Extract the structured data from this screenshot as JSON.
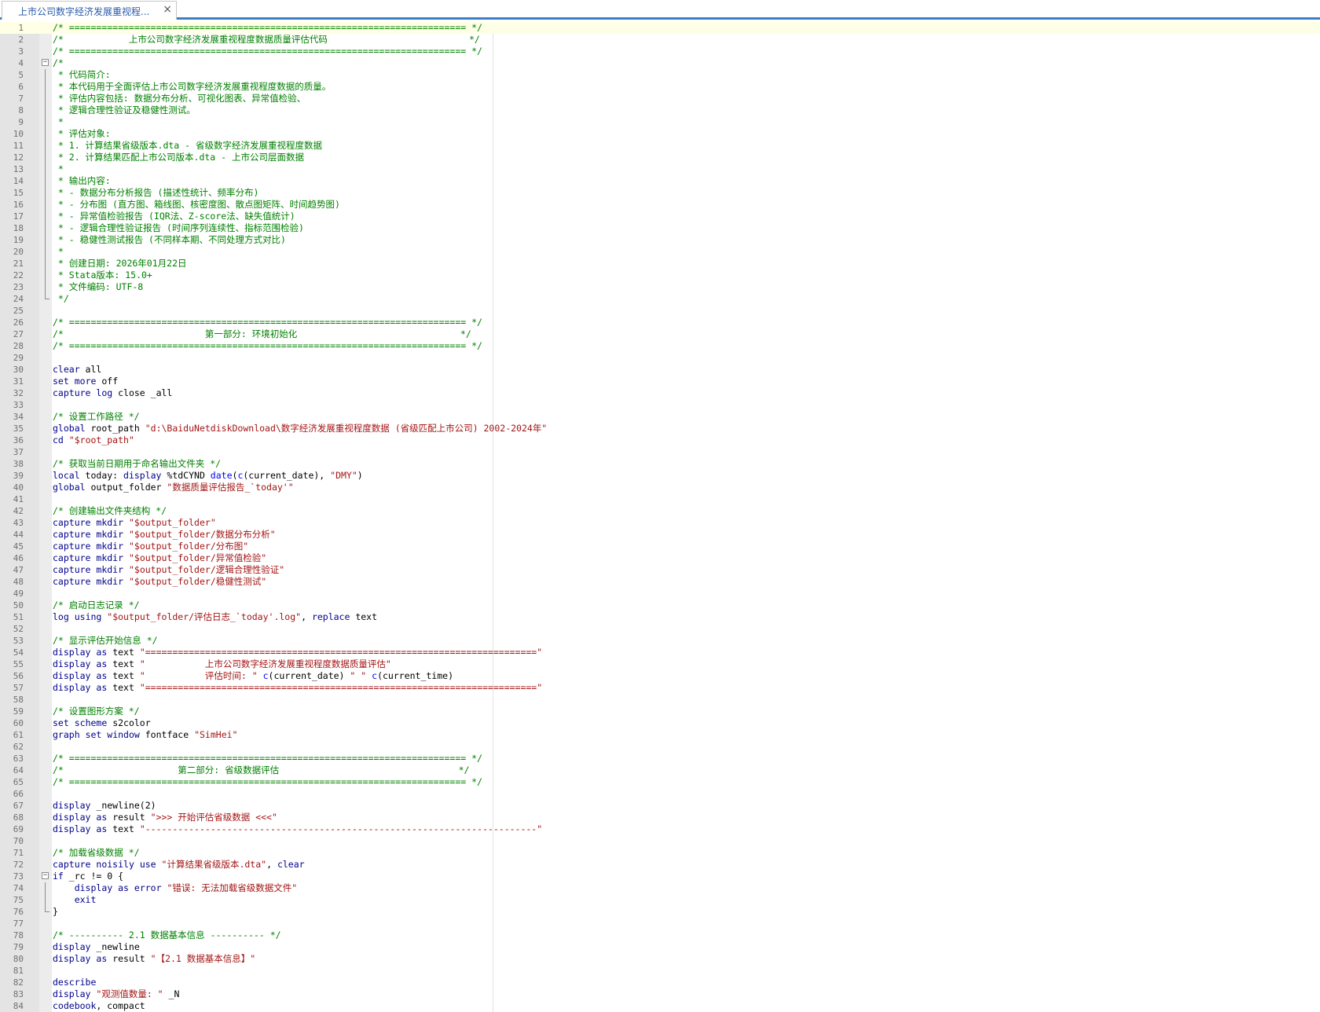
{
  "tab": {
    "title": "上市公司数字经济发展重视程...",
    "close": "×"
  },
  "colors": {
    "comment": "#008000",
    "keyword": "#00008b",
    "string": "#a31515",
    "function": "#0000ff",
    "text": "#000000",
    "active_line": "#ffffe6",
    "gutter": "#e4e4e4"
  },
  "fold_markers": {
    "4": "start",
    "24": "end",
    "73": "start",
    "76": "end"
  },
  "lines": [
    [
      [
        "c",
        "/* ========================================================================= */"
      ]
    ],
    [
      [
        "c",
        "/*            上市公司数字经济发展重视程度数据质量评估代码                          */"
      ]
    ],
    [
      [
        "c",
        "/* ========================================================================= */"
      ]
    ],
    [
      [
        "c",
        "/*"
      ]
    ],
    [
      [
        "c",
        " * 代码简介:"
      ]
    ],
    [
      [
        "c",
        " * 本代码用于全面评估上市公司数字经济发展重视程度数据的质量。"
      ]
    ],
    [
      [
        "c",
        " * 评估内容包括: 数据分布分析、可视化图表、异常值检验、"
      ]
    ],
    [
      [
        "c",
        " * 逻辑合理性验证及稳健性测试。"
      ]
    ],
    [
      [
        "c",
        " *"
      ]
    ],
    [
      [
        "c",
        " * 评估对象:"
      ]
    ],
    [
      [
        "c",
        " * 1. 计算结果省级版本.dta - 省级数字经济发展重视程度数据"
      ]
    ],
    [
      [
        "c",
        " * 2. 计算结果匹配上市公司版本.dta - 上市公司层面数据"
      ]
    ],
    [
      [
        "c",
        " *"
      ]
    ],
    [
      [
        "c",
        " * 输出内容:"
      ]
    ],
    [
      [
        "c",
        " * - 数据分布分析报告 (描述性统计、频率分布)"
      ]
    ],
    [
      [
        "c",
        " * - 分布图 (直方图、箱线图、核密度图、散点图矩阵、时间趋势图)"
      ]
    ],
    [
      [
        "c",
        " * - 异常值检验报告 (IQR法、Z-score法、缺失值统计)"
      ]
    ],
    [
      [
        "c",
        " * - 逻辑合理性验证报告 (时间序列连续性、指标范围检验)"
      ]
    ],
    [
      [
        "c",
        " * - 稳健性测试报告 (不同样本期、不同处理方式对比)"
      ]
    ],
    [
      [
        "c",
        " *"
      ]
    ],
    [
      [
        "c",
        " * 创建日期: 2026年01月22日"
      ]
    ],
    [
      [
        "c",
        " * Stata版本: 15.0+"
      ]
    ],
    [
      [
        "c",
        " * 文件编码: UTF-8"
      ]
    ],
    [
      [
        "c",
        " */"
      ]
    ],
    [],
    [
      [
        "c",
        "/* ========================================================================= */"
      ]
    ],
    [
      [
        "c",
        "/*                          第一部分: 环境初始化                              */"
      ]
    ],
    [
      [
        "c",
        "/* ========================================================================= */"
      ]
    ],
    [],
    [
      [
        "k",
        "clear"
      ],
      [
        "t",
        " all"
      ]
    ],
    [
      [
        "k",
        "set"
      ],
      [
        "t",
        " "
      ],
      [
        "k",
        "more"
      ],
      [
        "t",
        " off"
      ]
    ],
    [
      [
        "k",
        "capture"
      ],
      [
        "t",
        " "
      ],
      [
        "k",
        "log"
      ],
      [
        "t",
        " close _all"
      ]
    ],
    [],
    [
      [
        "c",
        "/* 设置工作路径 */"
      ]
    ],
    [
      [
        "k",
        "global"
      ],
      [
        "t",
        " root_path "
      ],
      [
        "s",
        "\"d:\\BaiduNetdiskDownload\\数字经济发展重视程度数据 (省级匹配上市公司) 2002-2024年\""
      ]
    ],
    [
      [
        "k",
        "cd"
      ],
      [
        "t",
        " "
      ],
      [
        "s",
        "\"$root_path\""
      ]
    ],
    [],
    [
      [
        "c",
        "/* 获取当前日期用于命名输出文件夹 */"
      ]
    ],
    [
      [
        "k",
        "local"
      ],
      [
        "t",
        " today: "
      ],
      [
        "k",
        "display"
      ],
      [
        "t",
        " %tdCYND "
      ],
      [
        "f",
        "date"
      ],
      [
        "t",
        "("
      ],
      [
        "f",
        "c"
      ],
      [
        "t",
        "(current_date), "
      ],
      [
        "s",
        "\"DMY\""
      ],
      [
        "t",
        ")"
      ]
    ],
    [
      [
        "k",
        "global"
      ],
      [
        "t",
        " output_folder "
      ],
      [
        "s",
        "\"数据质量评估报告_`today'\""
      ]
    ],
    [],
    [
      [
        "c",
        "/* 创建输出文件夹结构 */"
      ]
    ],
    [
      [
        "k",
        "capture"
      ],
      [
        "t",
        " "
      ],
      [
        "k",
        "mkdir"
      ],
      [
        "t",
        " "
      ],
      [
        "s",
        "\"$output_folder\""
      ]
    ],
    [
      [
        "k",
        "capture"
      ],
      [
        "t",
        " "
      ],
      [
        "k",
        "mkdir"
      ],
      [
        "t",
        " "
      ],
      [
        "s",
        "\"$output_folder/数据分布分析\""
      ]
    ],
    [
      [
        "k",
        "capture"
      ],
      [
        "t",
        " "
      ],
      [
        "k",
        "mkdir"
      ],
      [
        "t",
        " "
      ],
      [
        "s",
        "\"$output_folder/分布图\""
      ]
    ],
    [
      [
        "k",
        "capture"
      ],
      [
        "t",
        " "
      ],
      [
        "k",
        "mkdir"
      ],
      [
        "t",
        " "
      ],
      [
        "s",
        "\"$output_folder/异常值检验\""
      ]
    ],
    [
      [
        "k",
        "capture"
      ],
      [
        "t",
        " "
      ],
      [
        "k",
        "mkdir"
      ],
      [
        "t",
        " "
      ],
      [
        "s",
        "\"$output_folder/逻辑合理性验证\""
      ]
    ],
    [
      [
        "k",
        "capture"
      ],
      [
        "t",
        " "
      ],
      [
        "k",
        "mkdir"
      ],
      [
        "t",
        " "
      ],
      [
        "s",
        "\"$output_folder/稳健性测试\""
      ]
    ],
    [],
    [
      [
        "c",
        "/* 启动日志记录 */"
      ]
    ],
    [
      [
        "k",
        "log"
      ],
      [
        "t",
        " "
      ],
      [
        "k",
        "using"
      ],
      [
        "t",
        " "
      ],
      [
        "s",
        "\"$output_folder/评估日志_`today'.log\""
      ],
      [
        "t",
        ", "
      ],
      [
        "k",
        "replace"
      ],
      [
        "t",
        " text"
      ]
    ],
    [],
    [
      [
        "c",
        "/* 显示评估开始信息 */"
      ]
    ],
    [
      [
        "k",
        "display"
      ],
      [
        "t",
        " "
      ],
      [
        "k",
        "as"
      ],
      [
        "t",
        " text "
      ],
      [
        "s",
        "\"========================================================================\""
      ]
    ],
    [
      [
        "k",
        "display"
      ],
      [
        "t",
        " "
      ],
      [
        "k",
        "as"
      ],
      [
        "t",
        " text "
      ],
      [
        "s",
        "\"           上市公司数字经济发展重视程度数据质量评估\""
      ]
    ],
    [
      [
        "k",
        "display"
      ],
      [
        "t",
        " "
      ],
      [
        "k",
        "as"
      ],
      [
        "t",
        " text "
      ],
      [
        "s",
        "\"           评估时间: \""
      ],
      [
        "t",
        " "
      ],
      [
        "f",
        "c"
      ],
      [
        "t",
        "(current_date) "
      ],
      [
        "s",
        "\" \""
      ],
      [
        "t",
        " "
      ],
      [
        "f",
        "c"
      ],
      [
        "t",
        "(current_time)"
      ]
    ],
    [
      [
        "k",
        "display"
      ],
      [
        "t",
        " "
      ],
      [
        "k",
        "as"
      ],
      [
        "t",
        " text "
      ],
      [
        "s",
        "\"========================================================================\""
      ]
    ],
    [],
    [
      [
        "c",
        "/* 设置图形方案 */"
      ]
    ],
    [
      [
        "k",
        "set"
      ],
      [
        "t",
        " "
      ],
      [
        "k",
        "scheme"
      ],
      [
        "t",
        " s2color"
      ]
    ],
    [
      [
        "k",
        "graph"
      ],
      [
        "t",
        " "
      ],
      [
        "k",
        "set"
      ],
      [
        "t",
        " "
      ],
      [
        "k",
        "window"
      ],
      [
        "t",
        " fontface "
      ],
      [
        "s",
        "\"SimHei\""
      ]
    ],
    [],
    [
      [
        "c",
        "/* ========================================================================= */"
      ]
    ],
    [
      [
        "c",
        "/*                     第二部分: 省级数据评估                                 */"
      ]
    ],
    [
      [
        "c",
        "/* ========================================================================= */"
      ]
    ],
    [],
    [
      [
        "k",
        "display"
      ],
      [
        "t",
        " _newline(2)"
      ]
    ],
    [
      [
        "k",
        "display"
      ],
      [
        "t",
        " "
      ],
      [
        "k",
        "as"
      ],
      [
        "t",
        " result "
      ],
      [
        "s",
        "\">>> 开始评估省级数据 <<<\""
      ]
    ],
    [
      [
        "k",
        "display"
      ],
      [
        "t",
        " "
      ],
      [
        "k",
        "as"
      ],
      [
        "t",
        " text "
      ],
      [
        "s",
        "\"------------------------------------------------------------------------\""
      ]
    ],
    [],
    [
      [
        "c",
        "/* 加载省级数据 */"
      ]
    ],
    [
      [
        "k",
        "capture"
      ],
      [
        "t",
        " "
      ],
      [
        "k",
        "noisily"
      ],
      [
        "t",
        " "
      ],
      [
        "k",
        "use"
      ],
      [
        "t",
        " "
      ],
      [
        "s",
        "\"计算结果省级版本.dta\""
      ],
      [
        "t",
        ", "
      ],
      [
        "k",
        "clear"
      ]
    ],
    [
      [
        "k",
        "if"
      ],
      [
        "t",
        " _rc != 0 {"
      ]
    ],
    [
      [
        "t",
        "    "
      ],
      [
        "k",
        "display"
      ],
      [
        "t",
        " "
      ],
      [
        "k",
        "as"
      ],
      [
        "t",
        " "
      ],
      [
        "k",
        "error"
      ],
      [
        "t",
        " "
      ],
      [
        "s",
        "\"错误: 无法加载省级数据文件\""
      ]
    ],
    [
      [
        "t",
        "    "
      ],
      [
        "k",
        "exit"
      ]
    ],
    [
      [
        "t",
        "}"
      ]
    ],
    [],
    [
      [
        "c",
        "/* ---------- 2.1 数据基本信息 ---------- */"
      ]
    ],
    [
      [
        "k",
        "display"
      ],
      [
        "t",
        " _newline"
      ]
    ],
    [
      [
        "k",
        "display"
      ],
      [
        "t",
        " "
      ],
      [
        "k",
        "as"
      ],
      [
        "t",
        " result "
      ],
      [
        "s",
        "\"【2.1 数据基本信息】\""
      ]
    ],
    [],
    [
      [
        "k",
        "describe"
      ]
    ],
    [
      [
        "k",
        "display"
      ],
      [
        "t",
        " "
      ],
      [
        "s",
        "\"观测值数量: \""
      ],
      [
        "t",
        " _N"
      ]
    ],
    [
      [
        "k",
        "codebook"
      ],
      [
        "t",
        ", compact"
      ]
    ]
  ]
}
